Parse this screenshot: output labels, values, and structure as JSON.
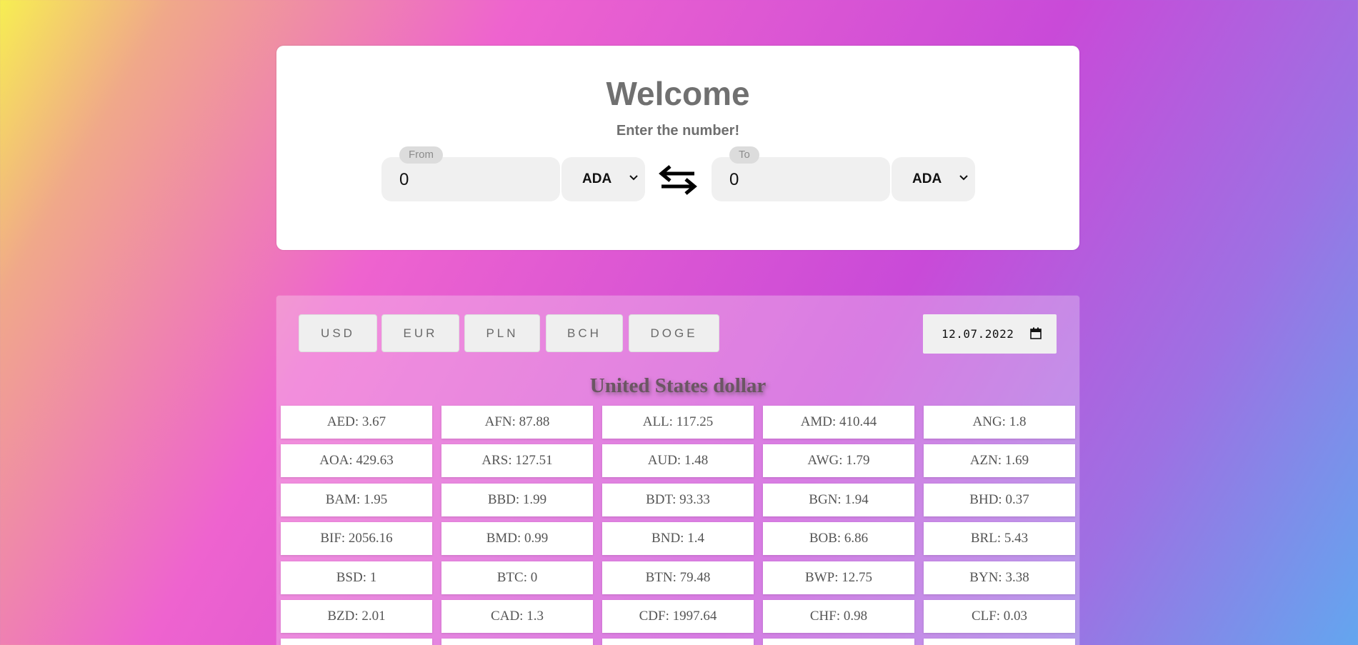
{
  "converter": {
    "title": "Welcome",
    "subtitle": "Enter the number!",
    "from": {
      "label": "From",
      "value": "0",
      "currency": "ADA"
    },
    "to": {
      "label": "To",
      "value": "0",
      "currency": "ADA"
    },
    "swap_icon": "swap-arrows-icon"
  },
  "rates_panel": {
    "tabs": [
      "USD",
      "EUR",
      "PLN",
      "BCH",
      "DOGE"
    ],
    "selected_tab": "USD",
    "date": "12.07.2022",
    "date_icon": "calendar-icon",
    "base_currency_name": "United States dollar",
    "rates": [
      "AED: 3.67",
      "AFN: 87.88",
      "ALL: 117.25",
      "AMD: 410.44",
      "ANG: 1.8",
      "AOA: 429.63",
      "ARS: 127.51",
      "AUD: 1.48",
      "AWG: 1.79",
      "AZN: 1.69",
      "BAM: 1.95",
      "BBD: 1.99",
      "BDT: 93.33",
      "BGN: 1.94",
      "BHD: 0.37",
      "BIF: 2056.16",
      "BMD: 0.99",
      "BND: 1.4",
      "BOB: 6.86",
      "BRL: 5.43",
      "BSD: 1",
      "BTC: 0",
      "BTN: 79.48",
      "BWP: 12.75",
      "BYN: 3.38",
      "BZD: 2.01",
      "CAD: 1.3",
      "CDF: 1997.64",
      "CHF: 0.98",
      "CLF: 0.03"
    ]
  },
  "colors": {
    "background_gradient": [
      "#f7ee52",
      "#ee63cf",
      "#c94ad8",
      "#63a6ef"
    ],
    "card": "#ffffff",
    "field": "#f0f0f0"
  }
}
